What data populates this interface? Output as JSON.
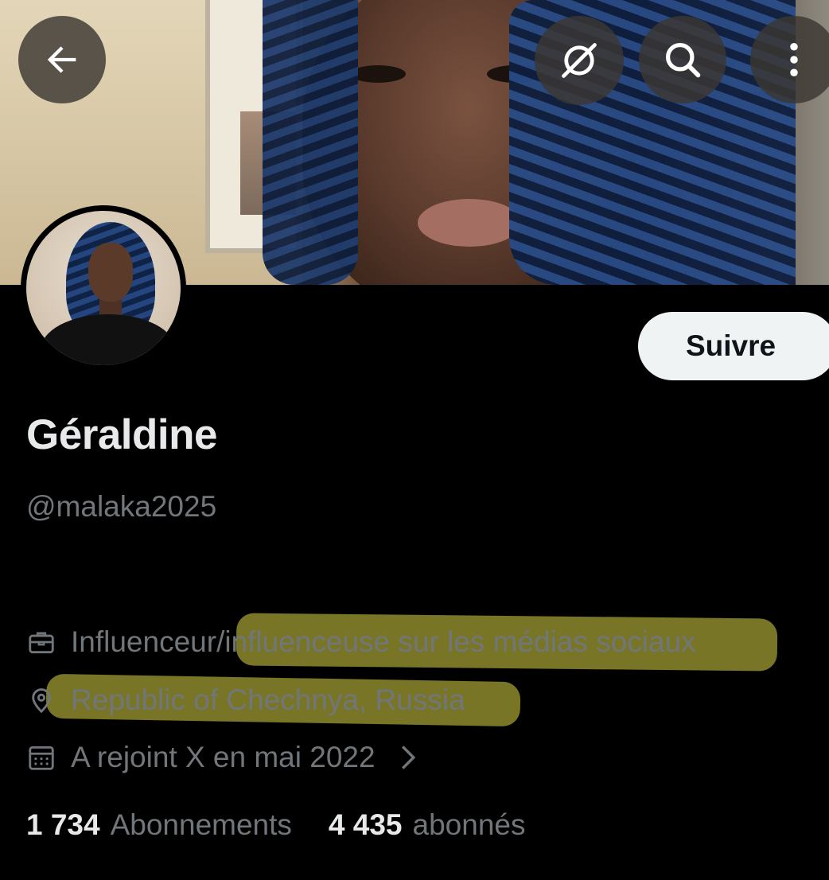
{
  "header": {
    "back_icon": "arrow-left-icon",
    "grok_icon": "grok-icon",
    "search_icon": "search-icon",
    "more_icon": "more-vertical-icon"
  },
  "profile": {
    "follow_label": "Suivre",
    "display_name": "Géraldine",
    "handle": "@malaka2025",
    "profession": "Influenceur/influenceuse sur les médias sociaux",
    "location": "Republic of Chechnya, Russia",
    "joined": "A rejoint X en mai 2022"
  },
  "stats": {
    "following_count": "1 734",
    "following_label": "Abonnements",
    "followers_count": "4 435",
    "followers_label": "abonnés"
  },
  "colors": {
    "background": "#000000",
    "text_primary": "#e7e9ea",
    "text_secondary": "#71767b",
    "button_bg": "#eff3f4",
    "highlight": "#86822a"
  }
}
